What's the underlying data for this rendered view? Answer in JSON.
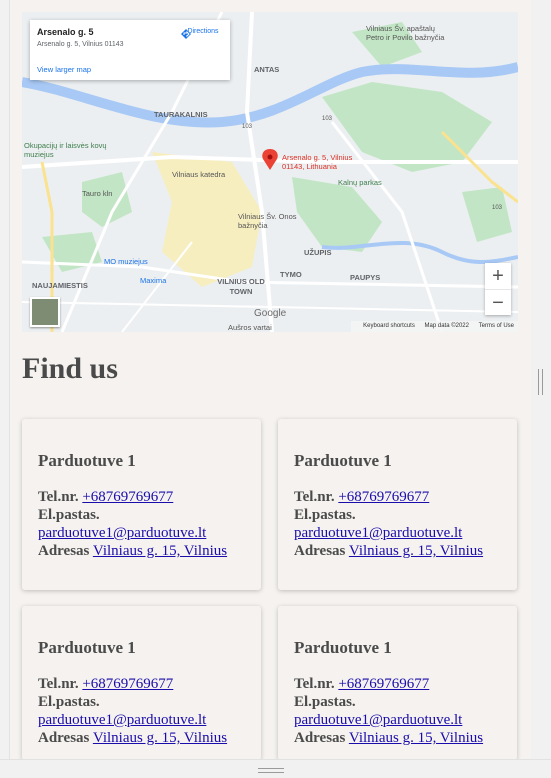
{
  "map": {
    "card": {
      "title": "Arsenalo g. 5",
      "address": "Arsenalo g. 5, Vilnius 01143",
      "larger_link": "View larger map",
      "directions": "Directions"
    },
    "pin_label": "Arsenalo g. 5, Vilnius 01143, Lithuania",
    "labels": {
      "taurakalnis": "TAURAKALNIS",
      "antas": "ANTAS",
      "church1": "Vilniaus Šv. apaštalų Petro ir Povilo bažnyčia",
      "museum": "Okupacijų ir laisvės kovų muziejus",
      "cathedral": "Vilniaus katedra",
      "kalnu": "Kalnų parkas",
      "church2": "Vilniaus Šv. Onos bažnyčia",
      "uzupis": "UŽUPIS",
      "tymo": "TYMO",
      "paupys": "PAUPYS",
      "mo": "MO muziejus",
      "maxima": "Maxima",
      "naujamiestis": "NAUJAMIESTIS",
      "oldtown": "VILNIUS OLD TOWN",
      "ausros": "Aušros vartai",
      "tauro": "Tauro kln",
      "road_103": "103",
      "road_103b": "103",
      "road_103c": "103"
    },
    "zoom_in": "+",
    "zoom_out": "−",
    "google": "Google",
    "attribution": {
      "shortcuts": "Keyboard shortcuts",
      "data": "Map data ©2022",
      "terms": "Terms of Use"
    },
    "colors": {
      "water": "#a8c9f5",
      "park": "#c2e6c5",
      "oldtown": "#f7eec0",
      "pin": "#ea4335"
    }
  },
  "heading": "Find us",
  "stores": [
    {
      "name": "Parduotuve 1",
      "tel_label": "Tel.nr.",
      "tel": "+68769769677",
      "email_label": "El.pastas.",
      "email": "parduotuve1@parduotuve.lt",
      "address_label": "Adresas",
      "address": "Vilniaus g. 15, Vilnius"
    },
    {
      "name": "Parduotuve 1",
      "tel_label": "Tel.nr.",
      "tel": "+68769769677",
      "email_label": "El.pastas.",
      "email": "parduotuve1@parduotuve.lt",
      "address_label": "Adresas",
      "address": "Vilniaus g. 15, Vilnius"
    },
    {
      "name": "Parduotuve 1",
      "tel_label": "Tel.nr.",
      "tel": "+68769769677",
      "email_label": "El.pastas.",
      "email": "parduotuve1@parduotuve.lt",
      "address_label": "Adresas",
      "address": "Vilniaus g. 15, Vilnius"
    },
    {
      "name": "Parduotuve 1",
      "tel_label": "Tel.nr.",
      "tel": "+68769769677",
      "email_label": "El.pastas.",
      "email": "parduotuve1@parduotuve.lt",
      "address_label": "Adresas",
      "address": "Vilniaus g. 15, Vilnius"
    }
  ]
}
